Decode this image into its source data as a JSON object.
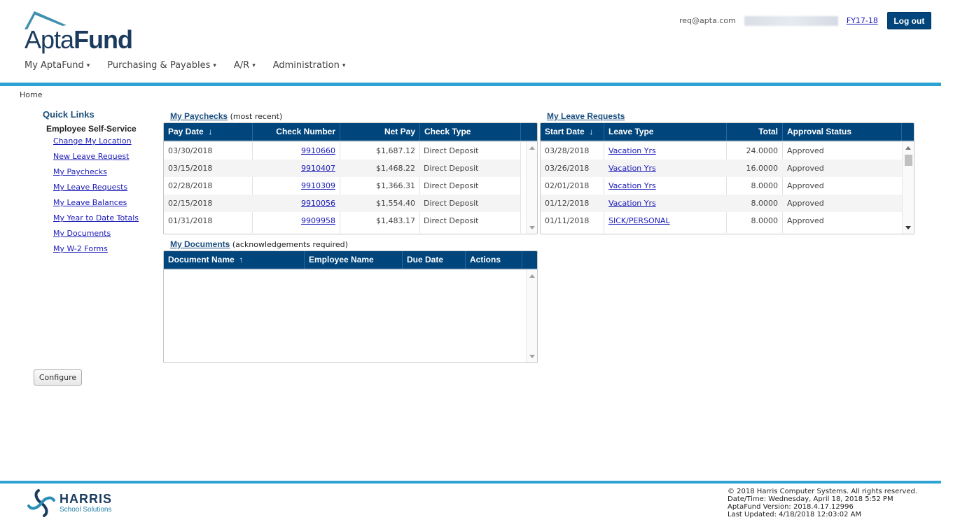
{
  "header": {
    "logo": {
      "part1": "Apta",
      "part2": "Fund"
    },
    "email": "req@apta.com",
    "fiscal_year": "FY17-18",
    "logout_label": "Log out"
  },
  "nav": {
    "items": [
      {
        "label": "My AptaFund",
        "caret": "▾"
      },
      {
        "label": "Purchasing & Payables",
        "caret": "▾"
      },
      {
        "label": "A/R",
        "caret": "▾"
      },
      {
        "label": "Administration",
        "caret": "▾"
      }
    ]
  },
  "breadcrumb": "Home",
  "sidebar": {
    "title": "Quick Links",
    "section": "Employee Self-Service",
    "links": [
      "Change My Location",
      "New Leave Request",
      "My Paychecks",
      "My Leave Requests",
      "My Leave Balances",
      "My Year to Date Totals",
      "My Documents",
      "My W-2 Forms"
    ],
    "configure_label": "Configure"
  },
  "paychecks": {
    "title": "My Paychecks",
    "subtitle": "(most recent)",
    "columns": [
      "Pay Date",
      "Check Number",
      "Net Pay",
      "Check Type"
    ],
    "sort_icon": "↓",
    "rows": [
      {
        "date": "03/30/2018",
        "check": "9910660",
        "net": "$1,687.12",
        "type": "Direct Deposit"
      },
      {
        "date": "03/15/2018",
        "check": "9910407",
        "net": "$1,468.22",
        "type": "Direct Deposit"
      },
      {
        "date": "02/28/2018",
        "check": "9910309",
        "net": "$1,366.31",
        "type": "Direct Deposit"
      },
      {
        "date": "02/15/2018",
        "check": "9910056",
        "net": "$1,554.40",
        "type": "Direct Deposit"
      },
      {
        "date": "01/31/2018",
        "check": "9909958",
        "net": "$1,483.17",
        "type": "Direct Deposit"
      }
    ]
  },
  "leave": {
    "title": "My Leave Requests",
    "columns": [
      "Start Date",
      "Leave Type",
      "Total",
      "Approval Status"
    ],
    "sort_icon": "↓",
    "rows": [
      {
        "date": "03/28/2018",
        "type": "Vacation Yrs",
        "total": "24.0000",
        "status": "Approved"
      },
      {
        "date": "03/26/2018",
        "type": "Vacation Yrs",
        "total": "16.0000",
        "status": "Approved"
      },
      {
        "date": "02/01/2018",
        "type": "Vacation Yrs",
        "total": "8.0000",
        "status": "Approved"
      },
      {
        "date": "01/12/2018",
        "type": "Vacation Yrs",
        "total": "8.0000",
        "status": "Approved"
      },
      {
        "date": "01/11/2018",
        "type": "SICK/PERSONAL",
        "total": "8.0000",
        "status": "Approved"
      }
    ]
  },
  "documents": {
    "title": "My Documents",
    "subtitle": "(acknowledgements required)",
    "columns": [
      "Document Name",
      "Employee Name",
      "Due Date",
      "Actions"
    ],
    "sort_icon": "↑"
  },
  "footer": {
    "company": "HARRIS",
    "division": "School Solutions",
    "copyright": "© 2018 Harris Computer Systems. All rights reserved.",
    "datetime": "Date/Time: Wednesday, April 18, 2018 5:52 PM",
    "version": "AptaFund Version: 2018.4.17.12996",
    "updated": "Last Updated: 4/18/2018 12:03:02 AM"
  },
  "colors": {
    "brand": "#00457c",
    "accent": "#2ea3d3",
    "link": "#1a1ab8"
  }
}
